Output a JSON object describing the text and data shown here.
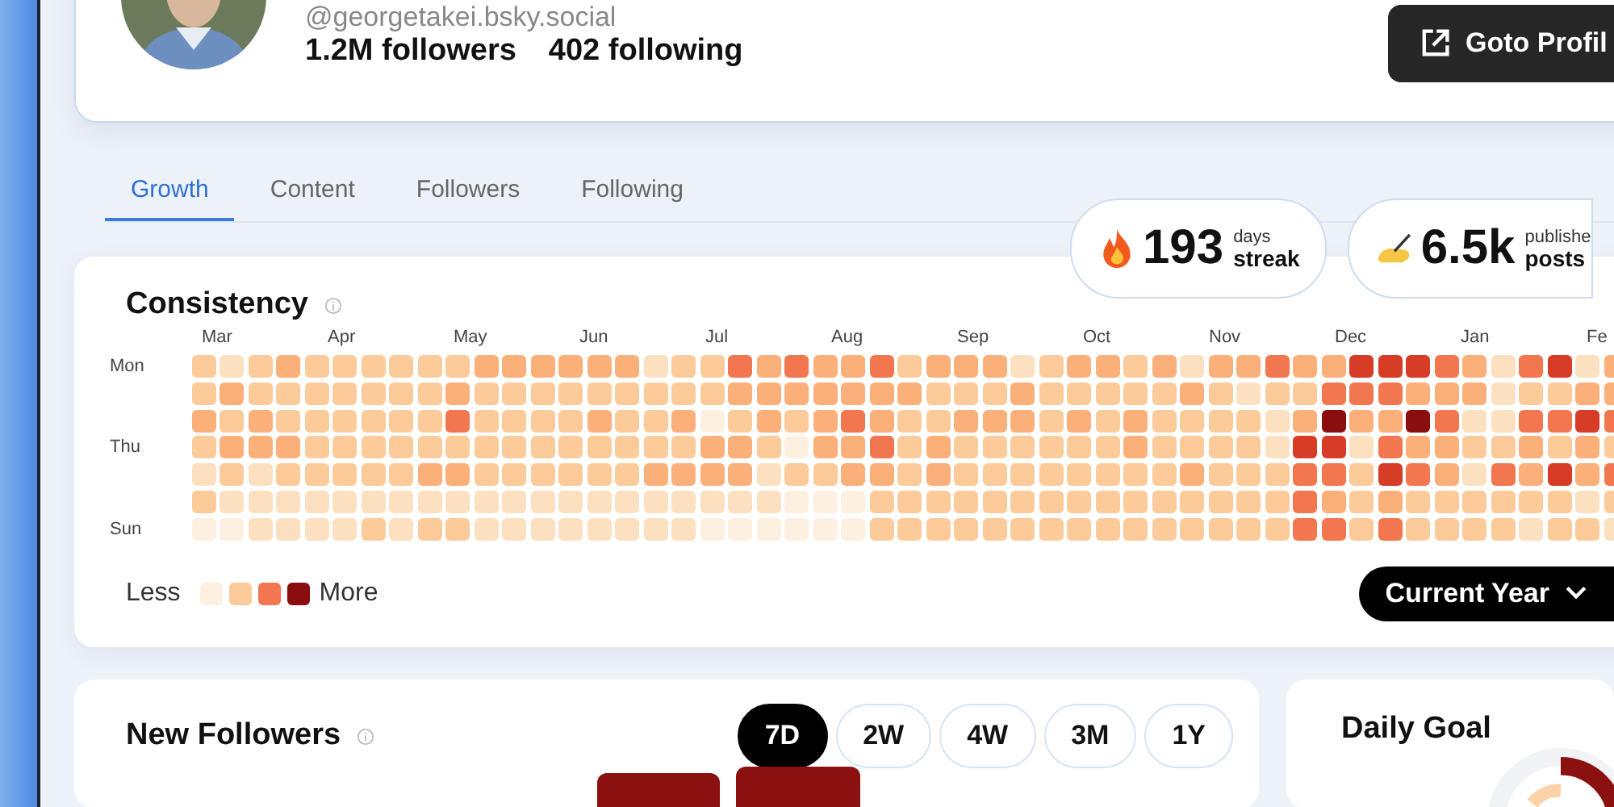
{
  "profile": {
    "handle": "@georgetakei.bsky.social",
    "followers": "1.2M followers",
    "following": "402 following",
    "button": "Goto Profil"
  },
  "tabs": [
    {
      "label": "Growth",
      "selected": true
    },
    {
      "label": "Content",
      "selected": false
    },
    {
      "label": "Followers",
      "selected": false
    },
    {
      "label": "Following",
      "selected": false
    }
  ],
  "stats": [
    {
      "kind": "streak",
      "value": "193",
      "small": "days",
      "big": "streak"
    },
    {
      "kind": "posts",
      "value": "6.5k",
      "small": "publishe",
      "big": "posts"
    }
  ],
  "consistency": {
    "title": "Consistency",
    "months": [
      "Mar",
      "Apr",
      "May",
      "Jun",
      "Jul",
      "Aug",
      "Sep",
      "Oct",
      "Nov",
      "Dec",
      "Jan",
      "Fe"
    ],
    "rows": [
      {
        "day": "Mon",
        "cells": [
          {
            "color": "#fdcb9a"
          },
          {
            "color": "#fde0c0"
          },
          {
            "color": "#fdcb9a"
          },
          {
            "color": "#fbb07a"
          },
          {
            "color": "#fdcb9a"
          },
          {
            "color": "#fdcb9a"
          },
          {
            "color": "#fdcb9a"
          },
          {
            "color": "#fdcb9a"
          },
          {
            "color": "#fdcb9a"
          },
          {
            "color": "#fdcb9a"
          },
          {
            "color": "#fbb07a"
          },
          {
            "color": "#fbb07a"
          },
          {
            "color": "#fbb07a"
          },
          {
            "color": "#fbb07a"
          },
          {
            "color": "#fbb07a"
          },
          {
            "color": "#fbb07a"
          },
          {
            "color": "#fde0c0"
          },
          {
            "color": "#fdcb9a"
          },
          {
            "color": "#fdcb9a"
          },
          {
            "color": "#f2774e"
          },
          {
            "color": "#fbb07a"
          },
          {
            "color": "#f2774e"
          },
          {
            "color": "#fbb07a"
          },
          {
            "color": "#fbb07a"
          },
          {
            "color": "#f2774e"
          },
          {
            "color": "#fdcb9a"
          },
          {
            "color": "#fbb07a"
          },
          {
            "color": "#fbb07a"
          },
          {
            "color": "#fbb07a"
          },
          {
            "color": "#fde0c0"
          },
          {
            "color": "#fdcb9a"
          },
          {
            "color": "#fbb07a"
          },
          {
            "color": "#fbb07a"
          },
          {
            "color": "#fdcb9a"
          },
          {
            "color": "#fbb07a"
          },
          {
            "color": "#fde0c0"
          },
          {
            "color": "#fbb07a"
          },
          {
            "color": "#fbb07a"
          },
          {
            "color": "#f2774e"
          },
          {
            "color": "#fbb07a"
          },
          {
            "color": "#fbb07a"
          },
          {
            "color": "#d73c26"
          },
          {
            "color": "#d73c26"
          },
          {
            "color": "#d73c26"
          },
          {
            "color": "#f2774e"
          },
          {
            "color": "#fbb07a"
          },
          {
            "color": "#fde0c0"
          },
          {
            "color": "#f2774e"
          },
          {
            "color": "#d73c26"
          },
          {
            "color": "#fde0c0"
          },
          {
            "color": "#fbb07a"
          }
        ]
      },
      {
        "cells": [
          {
            "color": "#fdcb9a"
          },
          {
            "color": "#fbb07a"
          },
          {
            "color": "#fdcb9a"
          },
          {
            "color": "#fdcb9a"
          },
          {
            "color": "#fdcb9a"
          },
          {
            "color": "#fdcb9a"
          },
          {
            "color": "#fdcb9a"
          },
          {
            "color": "#fdcb9a"
          },
          {
            "color": "#fdcb9a"
          },
          {
            "color": "#fbb07a"
          },
          {
            "color": "#fdcb9a"
          },
          {
            "color": "#fdcb9a"
          },
          {
            "color": "#fdcb9a"
          },
          {
            "color": "#fdcb9a"
          },
          {
            "color": "#fdcb9a"
          },
          {
            "color": "#fdcb9a"
          },
          {
            "color": "#fdcb9a"
          },
          {
            "color": "#fdcb9a"
          },
          {
            "color": "#fdcb9a"
          },
          {
            "color": "#fbb07a"
          },
          {
            "color": "#fbb07a"
          },
          {
            "color": "#fbb07a"
          },
          {
            "color": "#fbb07a"
          },
          {
            "color": "#fbb07a"
          },
          {
            "color": "#fbb07a"
          },
          {
            "color": "#fbb07a"
          },
          {
            "color": "#fdcb9a"
          },
          {
            "color": "#fdcb9a"
          },
          {
            "color": "#fdcb9a"
          },
          {
            "color": "#fbb07a"
          },
          {
            "color": "#fdcb9a"
          },
          {
            "color": "#fdcb9a"
          },
          {
            "color": "#fdcb9a"
          },
          {
            "color": "#fdcb9a"
          },
          {
            "color": "#fdcb9a"
          },
          {
            "color": "#fbb07a"
          },
          {
            "color": "#fdcb9a"
          },
          {
            "color": "#fde0c0"
          },
          {
            "color": "#fdcb9a"
          },
          {
            "color": "#fdcb9a"
          },
          {
            "color": "#f2774e"
          },
          {
            "color": "#f2774e"
          },
          {
            "color": "#f2774e"
          },
          {
            "color": "#fbb07a"
          },
          {
            "color": "#fbb07a"
          },
          {
            "color": "#fbb07a"
          },
          {
            "color": "#fde0c0"
          },
          {
            "color": "#fdcb9a"
          },
          {
            "color": "#fdcb9a"
          },
          {
            "color": "#fbb07a"
          },
          {
            "color": "#fbb07a"
          }
        ]
      },
      {
        "cells": [
          {
            "color": "#fbb07a"
          },
          {
            "color": "#fdcb9a"
          },
          {
            "color": "#fbb07a"
          },
          {
            "color": "#fdcb9a"
          },
          {
            "color": "#fdcb9a"
          },
          {
            "color": "#fdcb9a"
          },
          {
            "color": "#fdcb9a"
          },
          {
            "color": "#fdcb9a"
          },
          {
            "color": "#fdcb9a"
          },
          {
            "color": "#f2774e"
          },
          {
            "color": "#fdcb9a"
          },
          {
            "color": "#fdcb9a"
          },
          {
            "color": "#fdcb9a"
          },
          {
            "color": "#fdcb9a"
          },
          {
            "color": "#fbb07a"
          },
          {
            "color": "#fdcb9a"
          },
          {
            "color": "#fdcb9a"
          },
          {
            "color": "#fbb07a"
          },
          {
            "color": "#fdf0e0"
          },
          {
            "color": "#fdcb9a"
          },
          {
            "color": "#fbb07a"
          },
          {
            "color": "#fdcb9a"
          },
          {
            "color": "#fbb07a"
          },
          {
            "color": "#f2774e"
          },
          {
            "color": "#fbb07a"
          },
          {
            "color": "#fdcb9a"
          },
          {
            "color": "#fdcb9a"
          },
          {
            "color": "#fbb07a"
          },
          {
            "color": "#fbb07a"
          },
          {
            "color": "#fbb07a"
          },
          {
            "color": "#fdcb9a"
          },
          {
            "color": "#fbb07a"
          },
          {
            "color": "#fdcb9a"
          },
          {
            "color": "#fbb07a"
          },
          {
            "color": "#fdcb9a"
          },
          {
            "color": "#fdcb9a"
          },
          {
            "color": "#fdcb9a"
          },
          {
            "color": "#fdcb9a"
          },
          {
            "color": "#fde0c0"
          },
          {
            "color": "#fbb07a"
          },
          {
            "color": "#8b0e0e"
          },
          {
            "color": "#fbb07a"
          },
          {
            "color": "#fbb07a"
          },
          {
            "color": "#8b0e0e"
          },
          {
            "color": "#f2774e"
          },
          {
            "color": "#fde0c0"
          },
          {
            "color": "#fde0c0"
          },
          {
            "color": "#f2774e"
          },
          {
            "color": "#f2774e"
          },
          {
            "color": "#d73c26"
          },
          {
            "color": "#f2774e"
          }
        ]
      },
      {
        "day": "Thu",
        "cells": [
          {
            "color": "#fdcb9a"
          },
          {
            "color": "#fbb07a"
          },
          {
            "color": "#fbb07a"
          },
          {
            "color": "#fbb07a"
          },
          {
            "color": "#fdcb9a"
          },
          {
            "color": "#fdcb9a"
          },
          {
            "color": "#fdcb9a"
          },
          {
            "color": "#fdcb9a"
          },
          {
            "color": "#fdcb9a"
          },
          {
            "color": "#fdcb9a"
          },
          {
            "color": "#fdcb9a"
          },
          {
            "color": "#fdcb9a"
          },
          {
            "color": "#fdcb9a"
          },
          {
            "color": "#fdcb9a"
          },
          {
            "color": "#fdcb9a"
          },
          {
            "color": "#fdcb9a"
          },
          {
            "color": "#fdcb9a"
          },
          {
            "color": "#fdcb9a"
          },
          {
            "color": "#fbb07a"
          },
          {
            "color": "#fbb07a"
          },
          {
            "color": "#fdcb9a"
          },
          {
            "color": "#fdf0e0"
          },
          {
            "color": "#fbb07a"
          },
          {
            "color": "#fbb07a"
          },
          {
            "color": "#f2774e"
          },
          {
            "color": "#fdcb9a"
          },
          {
            "color": "#fbb07a"
          },
          {
            "color": "#fdcb9a"
          },
          {
            "color": "#fdcb9a"
          },
          {
            "color": "#fdcb9a"
          },
          {
            "color": "#fdcb9a"
          },
          {
            "color": "#fdcb9a"
          },
          {
            "color": "#fdcb9a"
          },
          {
            "color": "#fbb07a"
          },
          {
            "color": "#fdcb9a"
          },
          {
            "color": "#fdcb9a"
          },
          {
            "color": "#fdcb9a"
          },
          {
            "color": "#fdcb9a"
          },
          {
            "color": "#fde0c0"
          },
          {
            "color": "#d73c26"
          },
          {
            "color": "#d73c26"
          },
          {
            "color": "#fde0c0"
          },
          {
            "color": "#f2774e"
          },
          {
            "color": "#fbb07a"
          },
          {
            "color": "#fbb07a"
          },
          {
            "color": "#fdcb9a"
          },
          {
            "color": "#fdcb9a"
          },
          {
            "color": "#fbb07a"
          },
          {
            "color": "#fdcb9a"
          },
          {
            "color": "#fbb07a"
          },
          {
            "color": "#fdcb9a"
          }
        ]
      },
      {
        "cells": [
          {
            "color": "#fde0c0"
          },
          {
            "color": "#fdcb9a"
          },
          {
            "color": "#fde0c0"
          },
          {
            "color": "#fdcb9a"
          },
          {
            "color": "#fdcb9a"
          },
          {
            "color": "#fdcb9a"
          },
          {
            "color": "#fdcb9a"
          },
          {
            "color": "#fdcb9a"
          },
          {
            "color": "#fbb07a"
          },
          {
            "color": "#fbb07a"
          },
          {
            "color": "#fdcb9a"
          },
          {
            "color": "#fdcb9a"
          },
          {
            "color": "#fdcb9a"
          },
          {
            "color": "#fdcb9a"
          },
          {
            "color": "#fdcb9a"
          },
          {
            "color": "#fdcb9a"
          },
          {
            "color": "#fbb07a"
          },
          {
            "color": "#fbb07a"
          },
          {
            "color": "#fbb07a"
          },
          {
            "color": "#fbb07a"
          },
          {
            "color": "#fde0c0"
          },
          {
            "color": "#fdcb9a"
          },
          {
            "color": "#fdcb9a"
          },
          {
            "color": "#fbb07a"
          },
          {
            "color": "#fbb07a"
          },
          {
            "color": "#fdcb9a"
          },
          {
            "color": "#fbb07a"
          },
          {
            "color": "#fdcb9a"
          },
          {
            "color": "#fdcb9a"
          },
          {
            "color": "#fdcb9a"
          },
          {
            "color": "#fdcb9a"
          },
          {
            "color": "#fdcb9a"
          },
          {
            "color": "#fdcb9a"
          },
          {
            "color": "#fdcb9a"
          },
          {
            "color": "#fdcb9a"
          },
          {
            "color": "#fbb07a"
          },
          {
            "color": "#fdcb9a"
          },
          {
            "color": "#fdcb9a"
          },
          {
            "color": "#fdcb9a"
          },
          {
            "color": "#f2774e"
          },
          {
            "color": "#f2774e"
          },
          {
            "color": "#fdcb9a"
          },
          {
            "color": "#d73c26"
          },
          {
            "color": "#f2774e"
          },
          {
            "color": "#fbb07a"
          },
          {
            "color": "#fde0c0"
          },
          {
            "color": "#f2774e"
          },
          {
            "color": "#fbb07a"
          },
          {
            "color": "#d73c26"
          },
          {
            "color": "#fbb07a"
          },
          {
            "color": "#f2774e"
          }
        ]
      },
      {
        "cells": [
          {
            "color": "#fdcb9a"
          },
          {
            "color": "#fde0c0"
          },
          {
            "color": "#fde0c0"
          },
          {
            "color": "#fde0c0"
          },
          {
            "color": "#fde0c0"
          },
          {
            "color": "#fde0c0"
          },
          {
            "color": "#fde0c0"
          },
          {
            "color": "#fde0c0"
          },
          {
            "color": "#fde0c0"
          },
          {
            "color": "#fde0c0"
          },
          {
            "color": "#fde0c0"
          },
          {
            "color": "#fde0c0"
          },
          {
            "color": "#fde0c0"
          },
          {
            "color": "#fde0c0"
          },
          {
            "color": "#fde0c0"
          },
          {
            "color": "#fde0c0"
          },
          {
            "color": "#fde0c0"
          },
          {
            "color": "#fde0c0"
          },
          {
            "color": "#fde0c0"
          },
          {
            "color": "#fde0c0"
          },
          {
            "color": "#fde0c0"
          },
          {
            "color": "#fdf0e0"
          },
          {
            "color": "#fdf0e0"
          },
          {
            "color": "#fdf0e0"
          },
          {
            "color": "#fdcb9a"
          },
          {
            "color": "#fdcb9a"
          },
          {
            "color": "#fdcb9a"
          },
          {
            "color": "#fdcb9a"
          },
          {
            "color": "#fdcb9a"
          },
          {
            "color": "#fdcb9a"
          },
          {
            "color": "#fdcb9a"
          },
          {
            "color": "#fdcb9a"
          },
          {
            "color": "#fdcb9a"
          },
          {
            "color": "#fdcb9a"
          },
          {
            "color": "#fdcb9a"
          },
          {
            "color": "#fdcb9a"
          },
          {
            "color": "#fdcb9a"
          },
          {
            "color": "#fdcb9a"
          },
          {
            "color": "#fdcb9a"
          },
          {
            "color": "#f2774e"
          },
          {
            "color": "#fbb07a"
          },
          {
            "color": "#fdcb9a"
          },
          {
            "color": "#fbb07a"
          },
          {
            "color": "#fdcb9a"
          },
          {
            "color": "#fdcb9a"
          },
          {
            "color": "#fdcb9a"
          },
          {
            "color": "#fdcb9a"
          },
          {
            "color": "#fdcb9a"
          },
          {
            "color": "#fdcb9a"
          },
          {
            "color": "#fde0c0"
          },
          {
            "color": "#fdcb9a"
          }
        ]
      },
      {
        "day": "Sun",
        "cells": [
          {
            "color": "#fdf0e0"
          },
          {
            "color": "#fdf0e0"
          },
          {
            "color": "#fde0c0"
          },
          {
            "color": "#fde0c0"
          },
          {
            "color": "#fde0c0"
          },
          {
            "color": "#fde0c0"
          },
          {
            "color": "#fdcb9a"
          },
          {
            "color": "#fde0c0"
          },
          {
            "color": "#fdcb9a"
          },
          {
            "color": "#fdcb9a"
          },
          {
            "color": "#fde0c0"
          },
          {
            "color": "#fde0c0"
          },
          {
            "color": "#fde0c0"
          },
          {
            "color": "#fde0c0"
          },
          {
            "color": "#fde0c0"
          },
          {
            "color": "#fde0c0"
          },
          {
            "color": "#fde0c0"
          },
          {
            "color": "#fde0c0"
          },
          {
            "color": "#fdf0e0"
          },
          {
            "color": "#fdf0e0"
          },
          {
            "color": "#fdf0e0"
          },
          {
            "color": "#fdf0e0"
          },
          {
            "color": "#fdf0e0"
          },
          {
            "color": "#fdf0e0"
          },
          {
            "color": "#fdcb9a"
          },
          {
            "color": "#fdcb9a"
          },
          {
            "color": "#fdcb9a"
          },
          {
            "color": "#fdcb9a"
          },
          {
            "color": "#fdcb9a"
          },
          {
            "color": "#fdcb9a"
          },
          {
            "color": "#fdcb9a"
          },
          {
            "color": "#fdcb9a"
          },
          {
            "color": "#fdcb9a"
          },
          {
            "color": "#fdcb9a"
          },
          {
            "color": "#fdcb9a"
          },
          {
            "color": "#fdcb9a"
          },
          {
            "color": "#fdcb9a"
          },
          {
            "color": "#fdcb9a"
          },
          {
            "color": "#fdcb9a"
          },
          {
            "color": "#f2774e"
          },
          {
            "color": "#f2774e"
          },
          {
            "color": "#fdcb9a"
          },
          {
            "color": "#f2774e"
          },
          {
            "color": "#fdcb9a"
          },
          {
            "color": "#fdcb9a"
          },
          {
            "color": "#fdcb9a"
          },
          {
            "color": "#fdcb9a"
          },
          {
            "color": "#fde0c0"
          },
          {
            "color": "#fdcb9a"
          },
          {
            "color": "#fdcb9a"
          },
          {
            "color": "#fde0c0"
          }
        ]
      }
    ],
    "legend_less": "Less",
    "legend_more": "More",
    "period": "Current Year"
  },
  "new_followers": {
    "title": "New Followers",
    "ranges": [
      {
        "label": "7D",
        "selected": true
      },
      {
        "label": "2W",
        "selected": false
      },
      {
        "label": "4W",
        "selected": false
      },
      {
        "label": "3M",
        "selected": false
      },
      {
        "label": "1Y",
        "selected": false
      }
    ]
  },
  "daily_goal": {
    "title": "Daily Goal"
  }
}
